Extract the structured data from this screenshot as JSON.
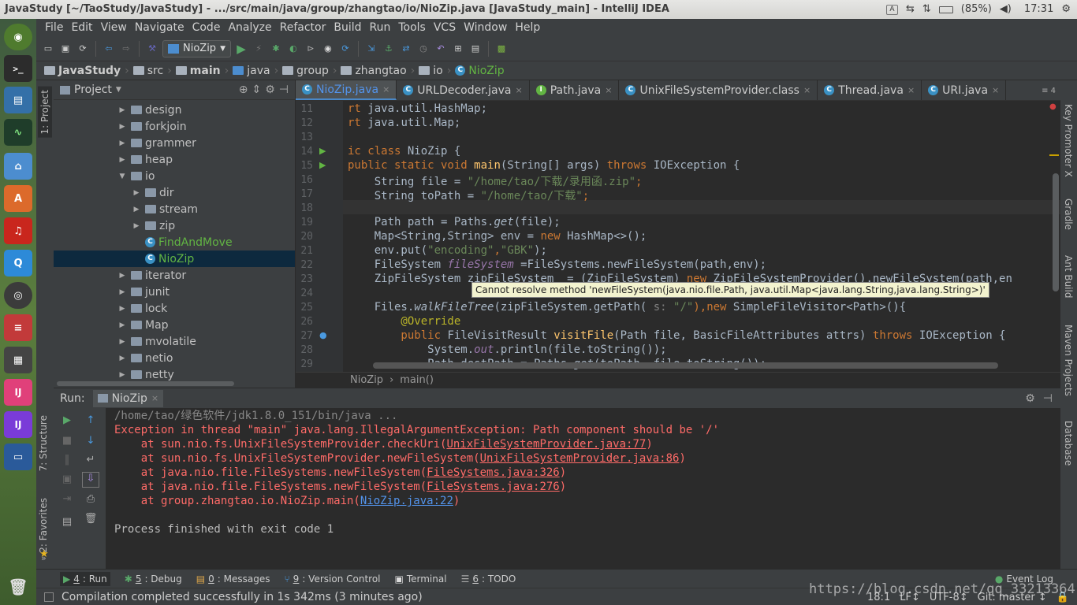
{
  "window": {
    "title": "JavaStudy [~/TaoStudy/JavaStudy] - .../src/main/java/group/zhangtao/io/NioZip.java [JavaStudy_main] - IntelliJ IDEA",
    "battery": "(85%)",
    "clock": "17:31",
    "input_indicator": "A"
  },
  "launcher": {
    "icons": [
      "ubuntu-dash-icon",
      "terminal-icon",
      "files-manager-icon",
      "system-monitor-icon",
      "home-folder-icon",
      "software-center-icon",
      "netease-music-icon",
      "qq-icon",
      "chrome-icon",
      "equalizer-icon",
      "calculator-icon",
      "intellij-icon",
      "intellij-active-icon",
      "workspace-icon",
      "trash-icon"
    ]
  },
  "menu": [
    "File",
    "Edit",
    "View",
    "Navigate",
    "Code",
    "Analyze",
    "Refactor",
    "Build",
    "Run",
    "Tools",
    "VCS",
    "Window",
    "Help"
  ],
  "toolbar": {
    "run_config": "NioZip"
  },
  "breadcrumbs": [
    "JavaStudy",
    "src",
    "main",
    "java",
    "group",
    "zhangtao",
    "io",
    "NioZip"
  ],
  "project": {
    "title": "Project",
    "tree": [
      {
        "label": "design",
        "depth": 0,
        "type": "folder",
        "open": false
      },
      {
        "label": "forkjoin",
        "depth": 0,
        "type": "folder",
        "open": false
      },
      {
        "label": "grammer",
        "depth": 0,
        "type": "folder",
        "open": false
      },
      {
        "label": "heap",
        "depth": 0,
        "type": "folder",
        "open": false
      },
      {
        "label": "io",
        "depth": 0,
        "type": "folder",
        "open": true
      },
      {
        "label": "dir",
        "depth": 1,
        "type": "folder",
        "open": false
      },
      {
        "label": "stream",
        "depth": 1,
        "type": "folder",
        "open": false
      },
      {
        "label": "zip",
        "depth": 1,
        "type": "folder",
        "open": false
      },
      {
        "label": "FindAndMove",
        "depth": 1,
        "type": "class"
      },
      {
        "label": "NioZip",
        "depth": 1,
        "type": "class",
        "selected": true
      },
      {
        "label": "iterator",
        "depth": 0,
        "type": "folder",
        "open": false
      },
      {
        "label": "junit",
        "depth": 0,
        "type": "folder",
        "open": false
      },
      {
        "label": "lock",
        "depth": 0,
        "type": "folder",
        "open": false
      },
      {
        "label": "Map",
        "depth": 0,
        "type": "folder",
        "open": false
      },
      {
        "label": "mvolatile",
        "depth": 0,
        "type": "folder",
        "open": false
      },
      {
        "label": "netio",
        "depth": 0,
        "type": "folder",
        "open": false
      },
      {
        "label": "netty",
        "depth": 0,
        "type": "folder",
        "open": false
      }
    ]
  },
  "tabs": [
    {
      "label": "NioZip.java",
      "active": true,
      "icon": "C"
    },
    {
      "label": "URLDecoder.java",
      "icon": "C"
    },
    {
      "label": "Path.java",
      "icon": "I"
    },
    {
      "label": "UnixFileSystemProvider.class",
      "icon": "C"
    },
    {
      "label": "Thread.java",
      "icon": "C"
    },
    {
      "label": "URI.java",
      "icon": "C"
    }
  ],
  "tabs_overflow": "≡ 4",
  "editor": {
    "line_numbers": [
      "11",
      "12",
      "13",
      "14",
      "15",
      "16",
      "17",
      "18",
      "19",
      "20",
      "21",
      "22",
      "23",
      "24",
      "25",
      "26",
      "27",
      "28",
      "29"
    ],
    "breadcrumb": [
      "NioZip",
      "main()"
    ],
    "tooltip": "Cannot resolve method 'newFileSystem(java.nio.file.Path, java.util.Map<java.lang.String,java.lang.String>)'",
    "code": {
      "l11a": "rt ",
      "l11b": "java.util.HashMap;",
      "l12a": "rt ",
      "l12b": "java.util.Map;",
      "l14a": "ic class ",
      "l14b": "NioZip {",
      "l15a": "public static void ",
      "l15b": "main",
      "l15c": "(String[] args) ",
      "l15d": "throws ",
      "l15e": "IOException {",
      "l16a": "    String file = ",
      "l16b": "\"/home/tao/下载/录用函.zip\"",
      "l16c": ";",
      "l17a": "    String toPath = ",
      "l17b": "\"/home/tao/下载\"",
      "l17c": ";",
      "l19a": "    Path path = Paths.",
      "l19b": "get",
      "l19c": "(file);",
      "l20a": "    Map<String,String> env = ",
      "l20b": "new ",
      "l20c": "HashMap<>();",
      "l21a": "    env.put(",
      "l21b": "\"encoding\"",
      "l21c": ",",
      "l21d": "\"GBK\"",
      "l21e": ");",
      "l22a": "    FileSystem ",
      "l22b": "fileSystem",
      "l22c": " =FileSystems.newFileSystem(path,env);",
      "l23a": "    ZipFileSystem zipFileSystem  = (ZipFileSystem) ",
      "l23b": "new ",
      "l23c": "ZipFileSystemProvider().newFileSystem(path,en",
      "l25a": "    Files.",
      "l25b": "walkFileTree",
      "l25c": "(zipFileSystem.getPath( ",
      "l25d": "s: ",
      "l25e": "\"/\"",
      "l25f": "),",
      "l25g": "new ",
      "l25h": "SimpleFileVisitor<Path>(){",
      "l26a": "        @Override",
      "l27a": "        public ",
      "l27b": "FileVisitResult ",
      "l27c": "visitFile",
      "l27d": "(Path file, BasicFileAttributes attrs) ",
      "l27e": "throws ",
      "l27f": "IOException {",
      "l28a": "            System.",
      "l28b": "out",
      "l28c": ".println(file.toString());",
      "l29a": "            Path destPath = Paths.",
      "l29b": "get",
      "l29c": "(toPath, file.toString());"
    }
  },
  "right_tools": [
    "Key Promoter X",
    "Gradle",
    "Ant Build",
    "Maven Projects",
    "Database"
  ],
  "left_tools": [
    "1: Project",
    "7: Structure",
    "2: Favorites"
  ],
  "run": {
    "title": "Run:",
    "config": "NioZip",
    "output": {
      "l1": "/home/tao/绿色软件/jdk1.8.0_151/bin/java ...",
      "l2": "Exception in thread \"main\" java.lang.IllegalArgumentException: Path component should be '/'",
      "l3a": "    at sun.nio.fs.UnixFileSystemProvider.checkUri(",
      "l3b": "UnixFileSystemProvider.java:77",
      "l3c": ")",
      "l4a": "    at sun.nio.fs.UnixFileSystemProvider.newFileSystem(",
      "l4b": "UnixFileSystemProvider.java:86",
      "l4c": ")",
      "l5a": "    at java.nio.file.FileSystems.newFileSystem(",
      "l5b": "FileSystems.java:326",
      "l5c": ")",
      "l6a": "    at java.nio.file.FileSystems.newFileSystem(",
      "l6b": "FileSystems.java:276",
      "l6c": ")",
      "l7a": "    at group.zhangtao.io.NioZip.main(",
      "l7b": "NioZip.java:22",
      "l7c": ")",
      "l9": "Process finished with exit code 1"
    }
  },
  "bottom_tabs": [
    {
      "key": "4",
      "label": ": Run"
    },
    {
      "key": "5",
      "label": ": Debug"
    },
    {
      "key": "0",
      "label": ": Messages"
    },
    {
      "key": "9",
      "label": ": Version Control"
    },
    {
      "key": "",
      "label": "Terminal"
    },
    {
      "key": "6",
      "label": ": TODO"
    }
  ],
  "event_log": "Event Log",
  "status": {
    "message": "Compilation completed successfully in 1s 342ms (3 minutes ago)",
    "position": "18:1",
    "line_sep": "LF↕",
    "encoding": "UTF-8↕",
    "git": "Git: master ↕"
  },
  "watermark": "https://blog.csdn.net/qq_33213364"
}
